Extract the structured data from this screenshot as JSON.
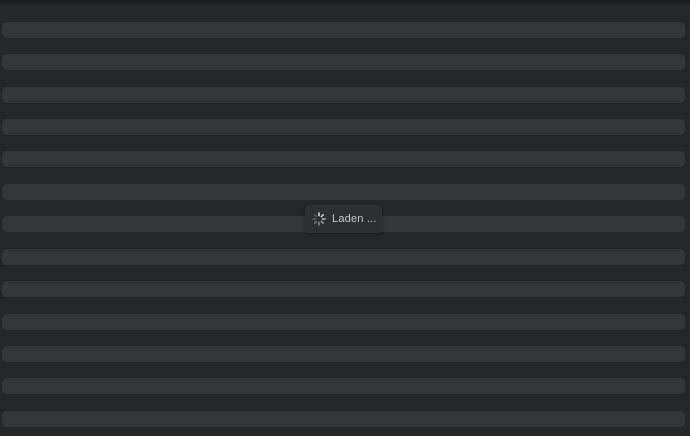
{
  "loading": {
    "label": "Laden ...",
    "icon": "spinner-icon"
  },
  "skeleton": {
    "row_count": 13
  },
  "colors": {
    "background": "#24272a",
    "row": "#33373a",
    "overlay": "#2d3033",
    "text": "#c7c9cb"
  }
}
